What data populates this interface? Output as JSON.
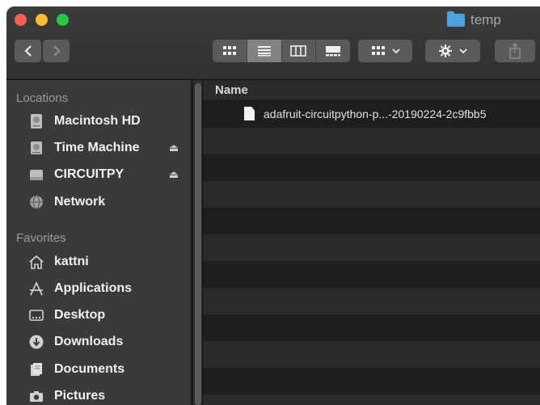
{
  "window": {
    "title": "temp",
    "controls": {
      "close_color": "#fe5f57",
      "minimize_color": "#febc2e",
      "zoom_color": "#28c840"
    }
  },
  "toolbar": {
    "back_icon": "chevron-left-icon",
    "forward_icon": "chevron-right-icon",
    "view_modes": [
      "icon-view",
      "list-view",
      "column-view",
      "gallery-view"
    ],
    "active_view": "list-view",
    "group_icon": "group-grid-icon",
    "action_icon": "gear-icon",
    "share_icon": "share-icon"
  },
  "sidebar": {
    "locations_label": "Locations",
    "locations": [
      {
        "label": "Macintosh HD",
        "icon": "hard-drive-icon",
        "eject": false
      },
      {
        "label": "Time Machine",
        "icon": "external-drive-icon",
        "eject": true
      },
      {
        "label": "CIRCUITPY",
        "icon": "usb-drive-icon",
        "eject": true
      },
      {
        "label": "Network",
        "icon": "globe-icon",
        "eject": false
      }
    ],
    "favorites_label": "Favorites",
    "favorites": [
      {
        "label": "kattni",
        "icon": "home-icon"
      },
      {
        "label": "Applications",
        "icon": "applications-icon"
      },
      {
        "label": "Desktop",
        "icon": "desktop-icon"
      },
      {
        "label": "Downloads",
        "icon": "downloads-icon"
      },
      {
        "label": "Documents",
        "icon": "documents-icon"
      },
      {
        "label": "Pictures",
        "icon": "camera-icon"
      }
    ]
  },
  "content": {
    "column_header": "Name",
    "files": [
      {
        "name": "adafruit-circuitpython-p...-20190224-2c9fbb5",
        "icon": "document-icon"
      }
    ]
  }
}
